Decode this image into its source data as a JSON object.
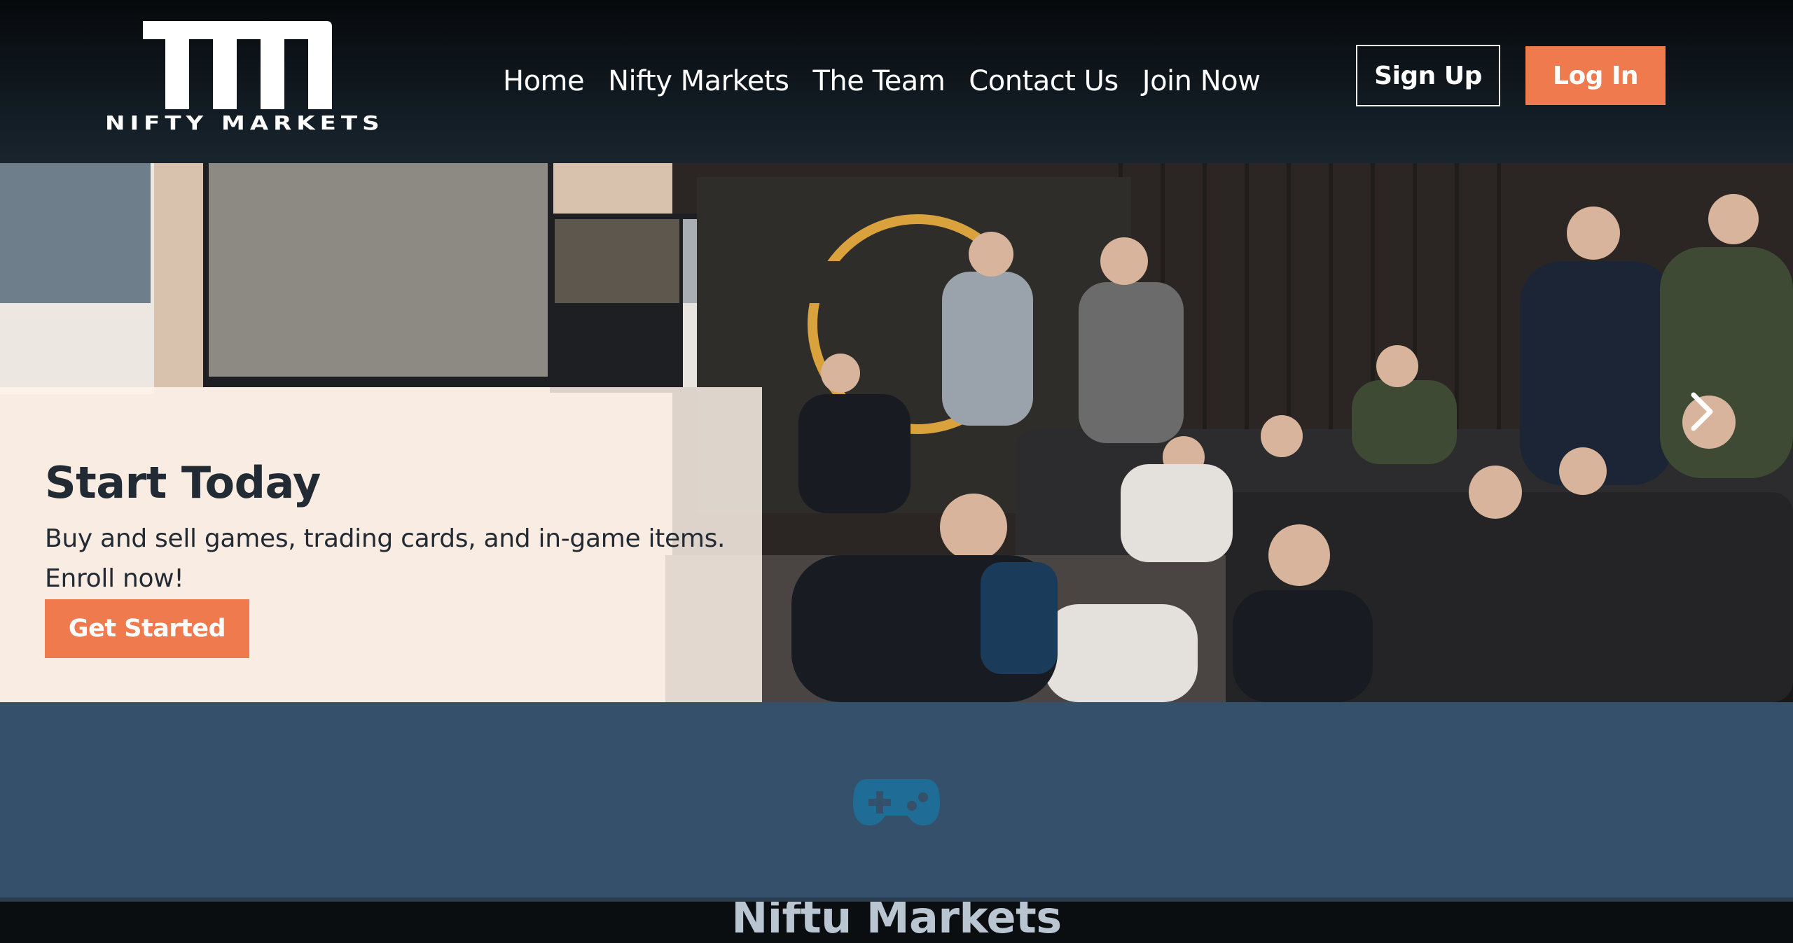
{
  "header": {
    "logo_text": "NIFTY MARKETS",
    "nav": [
      {
        "label": "Home"
      },
      {
        "label": "Nifty Markets"
      },
      {
        "label": "The Team"
      },
      {
        "label": "Contact Us"
      },
      {
        "label": "Join Now"
      }
    ],
    "signup_label": "Sign Up",
    "login_label": "Log In"
  },
  "hero": {
    "title": "Start Today",
    "text": "Buy and sell games, trading cards, and in-game items. Enroll now!",
    "cta_label": "Get Started",
    "next_icon": "chevron-right-icon"
  },
  "about": {
    "icon": "gamepad-icon",
    "title": "Niftu Markets"
  },
  "colors": {
    "accent": "#ef7a4e",
    "header_bg": "#0b0e11",
    "section_bg": "#34506a",
    "gamepad": "#1f6d96"
  }
}
